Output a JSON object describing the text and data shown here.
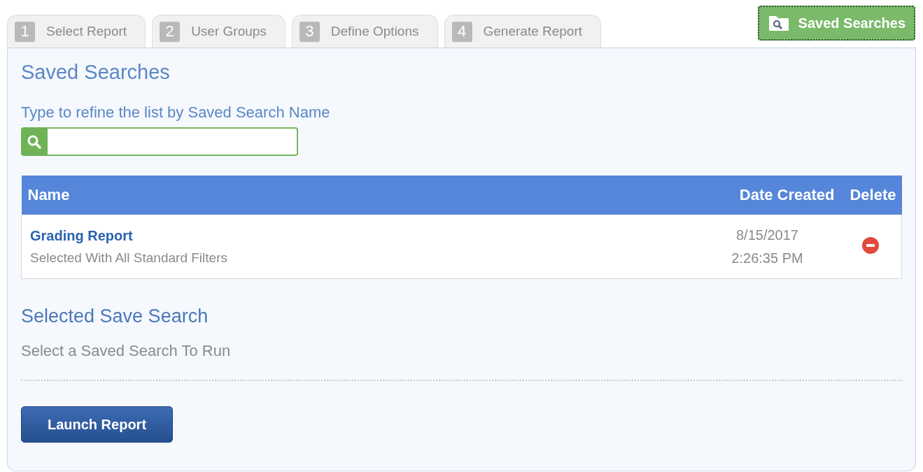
{
  "tabs": [
    {
      "number": "1",
      "label": "Select Report",
      "selected": false
    },
    {
      "number": "2",
      "label": "User Groups",
      "selected": false
    },
    {
      "number": "3",
      "label": "Define Options",
      "selected": false
    },
    {
      "number": "4",
      "label": "Generate Report",
      "selected": false
    }
  ],
  "saved_searches_button": {
    "label": "Saved Searches"
  },
  "title": "Saved Searches",
  "search": {
    "label": "Type to refine the list by Saved Search Name"
  },
  "table": {
    "columns": [
      "Name",
      "Date Created",
      "Delete"
    ],
    "rows": [
      {
        "name": "Grading Report",
        "description": "Selected With All Standard Filters",
        "date": "8/15/2017",
        "time": "2:26:35 PM"
      }
    ]
  },
  "selected_section": {
    "title": "Selected Save Search",
    "message": "Select a Saved Search To Run"
  },
  "launch_button": {
    "label": "Launch Report"
  }
}
